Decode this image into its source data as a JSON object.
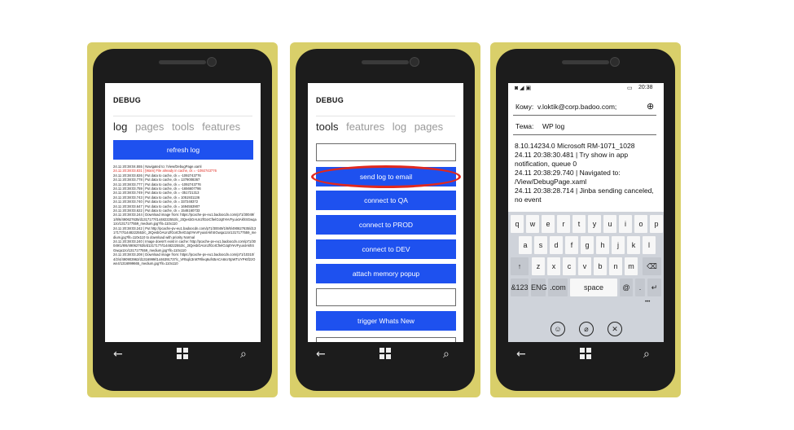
{
  "phones": [
    {
      "app_title": "DEBUG",
      "pivots": [
        "log",
        "pages",
        "tools",
        "features"
      ],
      "refresh_label": "refresh log",
      "log_lines": [
        {
          "text": "24.11 20:38:04.555 | Navigated to: /View/DebugPage.xaml",
          "warn": false
        },
        {
          "text": "24.11 20:38:03.831 | [Warn] File already in cache, ck = -1092743776",
          "warn": true
        },
        {
          "text": "24.11 20:38:03.826 | Put data to cache, ck = -1092743776",
          "warn": false
        },
        {
          "text": "24.11 20:38:03.778 | Put data to cache, ck = 1379008367",
          "warn": false
        },
        {
          "text": "24.11 20:38:03.777 | Put data to cache, ck = -1092743776",
          "warn": false
        },
        {
          "text": "24.11 20:38:03.759 | Put data to cache, ck = -1656607786",
          "warn": false
        },
        {
          "text": "24.11 20:38:03.749 | Put data to cache, ck = -351721313",
          "warn": false
        },
        {
          "text": "24.11 20:38:03.743 | Put data to cache, ck = 1051931136",
          "warn": false
        },
        {
          "text": "24.11 20:38:03.740 | Put data to cache, ck = 337248372",
          "warn": false
        },
        {
          "text": "24.11 20:38:03.647 | Put data to cache, ck = 1694553907",
          "warn": false
        },
        {
          "text": "24.11 20:38:03.622 | Put data to cache, ck = 1546160733",
          "warn": false
        },
        {
          "text": "24.11 20:38:03.244 | Download image from: https://pcache-pv-eu1.badoocdn.com/p71/30049/1/8/6/490627635/d1317177/t1448222553/c_2tQesbOAUn2fGoICfIelOJq0YeVFyuixtAkhSGwqa1zo/1317177559_medium.jpg?fit=110x110",
          "warn": false
        },
        {
          "text": "24.11 20:38:03.242 | Put http://pcache-pv-eu1.badoocdn.com/p71/30049/1/8/6/490627635/d1317177/t1448222553/c_2tQesbOAUn2fGoICfIelOJq0YeVFyuixtAkhSGwqa1zo/1317177559_medium.jpg?fit=110x110 to download with priority Normal",
          "warn": false
        },
        {
          "text": "24.11 20:38:03.240 | Image doesn't exist in cache: http://pcache-pv-eu1.badoocdn.com/p71/30049/1/8/6/490627635/d1317177/t1448222553/c_2tQesbOAUn2fGoICfIelOJq0YeVFyuixtAkhSGwqa1zo/1317177559_medium.jpg?fit=110x110",
          "warn": false
        },
        {
          "text": "24.11 20:38:03.208 | Download image from: https://pcache-pv-eu1.badoocdn.com/p71/10310/4/2/4/490903962/d1316999/t1446391737/c_VR5qlc3n97Rlleq6ufst5ACA6Icr0pWTUYPKtf2zOwn4/1316999665_medium.jpg?fit=110x110",
          "warn": false
        }
      ],
      "nav": {
        "back": "←",
        "search": "⌕"
      }
    },
    {
      "app_title": "DEBUG",
      "pivots": [
        "tools",
        "features",
        "log",
        "pages"
      ],
      "input_value": "",
      "buttons": [
        "send log to email",
        "connect to QA",
        "connect to PROD",
        "connect to DEV",
        "attach memory popup"
      ],
      "input2_value": "",
      "last_button": "trigger Whats New",
      "nav": {
        "back": "←",
        "search": "⌕"
      }
    },
    {
      "status": {
        "left": "◙ ◢ ▣",
        "battery": "▭",
        "time": "20:38"
      },
      "to_label": "Кому:",
      "to_value": "v.loktik@corp.badoo.com;",
      "add_icon": "⊕",
      "subject_label": "Тема:",
      "subject_value": "WP log",
      "body_lines": [
        "8.10.14234.0 Microsoft RM-1071_1028",
        "24.11 20:38:30.481 | Try show in app notification, queue 0",
        "24.11 20:38:29.740 | Navigated to: /View/DebugPage.xaml",
        "24.11 20:38:28.714 | Jinba sending canceled, no event"
      ],
      "keyboard": {
        "row1": [
          "q",
          "w",
          "e",
          "r",
          "t",
          "y",
          "u",
          "i",
          "o",
          "p"
        ],
        "row2": [
          "a",
          "s",
          "d",
          "f",
          "g",
          "h",
          "j",
          "k",
          "l"
        ],
        "row3": [
          "z",
          "x",
          "c",
          "v",
          "b",
          "n",
          "m"
        ],
        "shift": "↑",
        "backspace": "⌫",
        "sym": "&123",
        "lang": "ENG",
        "com": ".com",
        "space": "space",
        "at": "@",
        "dot": ".",
        "enter": "↵",
        "more": "•••"
      },
      "bottom_icons": [
        "☺",
        "⌀",
        "✕"
      ],
      "nav": {
        "back": "←",
        "search": "⌕"
      }
    }
  ]
}
